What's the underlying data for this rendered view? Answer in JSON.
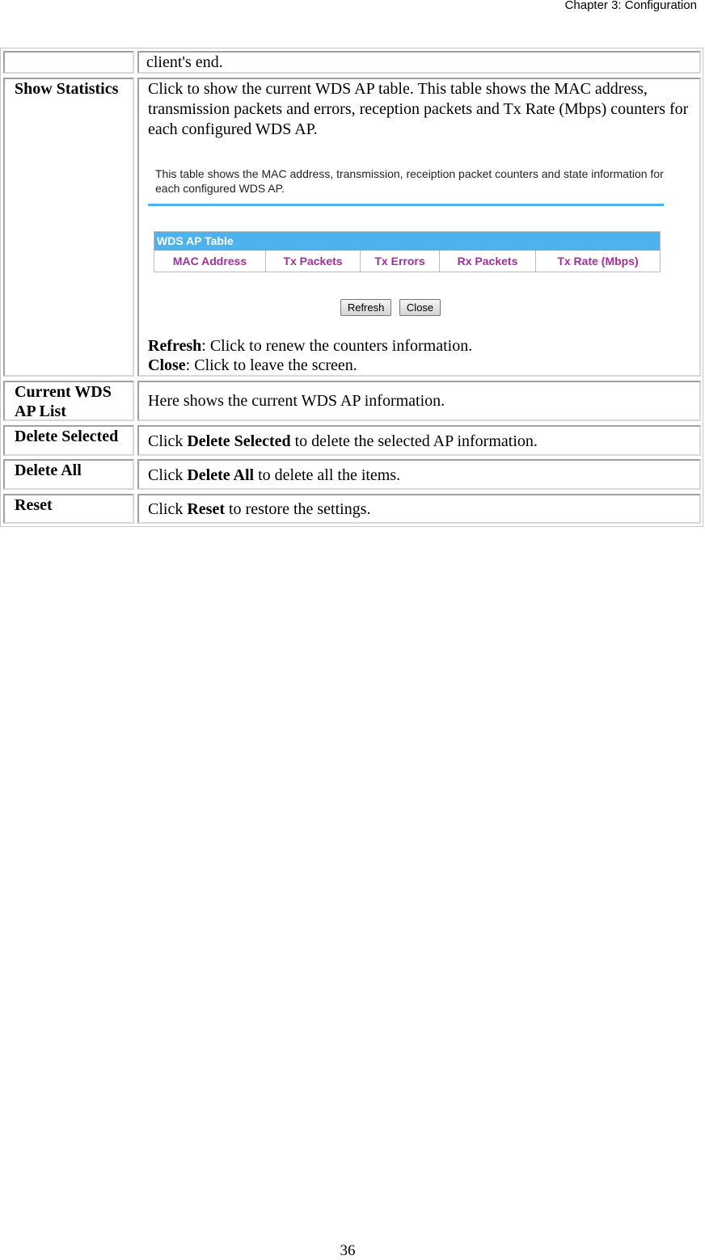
{
  "header": {
    "chapter": "Chapter 3: Configuration"
  },
  "rows": [
    {
      "label": "",
      "desc": "client's end."
    },
    {
      "label": "Show Statistics",
      "desc": "Click to show the current WDS AP table. This table shows the MAC address, transmission packets and errors, reception packets and Tx Rate (Mbps) counters for each configured WDS AP.",
      "screenshot": {
        "description": "This table shows the MAC address, transmission, receiption packet counters and state information for each configured WDS AP.",
        "table_title": "WDS AP Table",
        "columns": [
          "MAC Address",
          "Tx Packets",
          "Tx Errors",
          "Rx Packets",
          "Tx Rate (Mbps)"
        ],
        "refresh": "Refresh",
        "close": "Close",
        "accent": "#4db3ee",
        "column_color": "#a0309a"
      },
      "refresh_term": "Refresh",
      "refresh_text": ": Click to renew the counters information.",
      "close_term": "Close",
      "close_text": ": Click to leave the screen."
    },
    {
      "label": "Current WDS AP List",
      "desc": "Here shows the current WDS AP information."
    },
    {
      "label": "Delete Selected",
      "pre": "Click ",
      "term": "Delete Selected",
      "post": " to delete the selected AP information."
    },
    {
      "label": "Delete All",
      "pre": "Click ",
      "term": "Delete All",
      "post": " to delete all the items."
    },
    {
      "label": "Reset",
      "pre": "Click ",
      "term": "Reset",
      "post": " to restore the settings."
    }
  ],
  "footer": {
    "page": "36"
  }
}
